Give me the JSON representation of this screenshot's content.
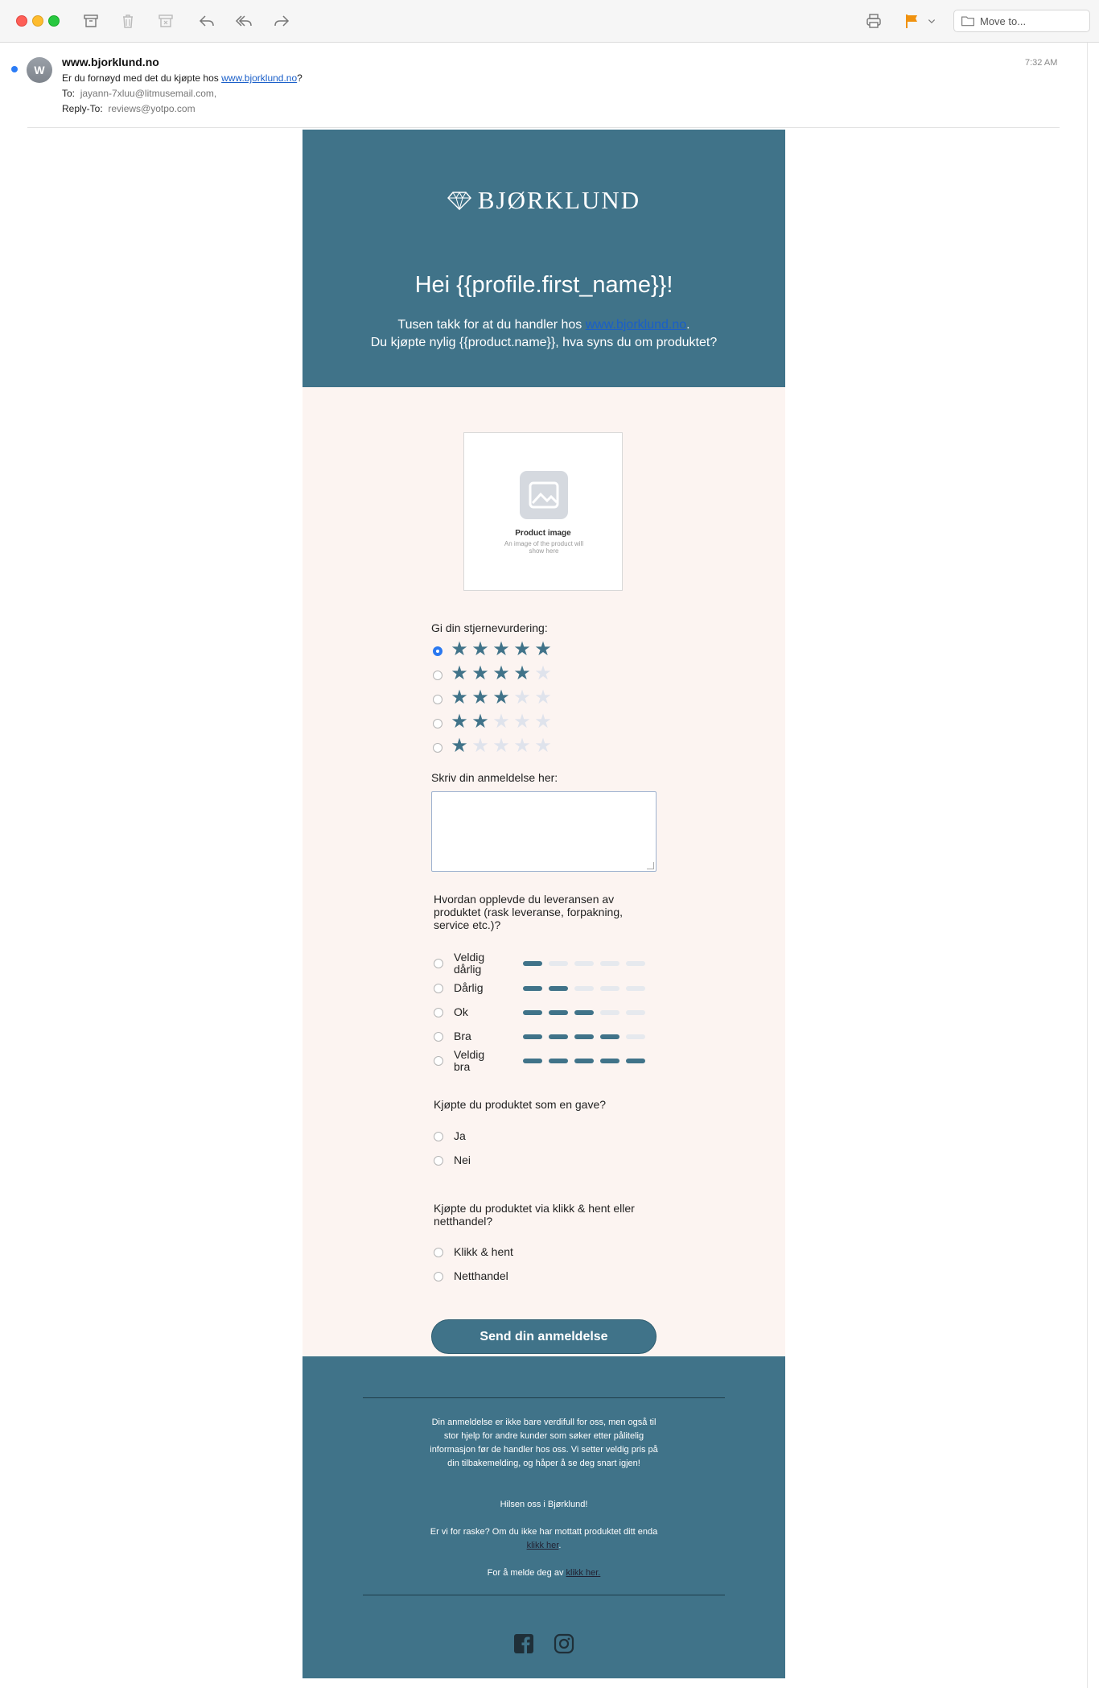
{
  "toolbar": {
    "move_to_placeholder": "Move to..."
  },
  "message": {
    "avatar_initial": "W",
    "sender": "www.bjorklund.no",
    "subject_prefix": "Er du fornøyd med det du kjøpte hos ",
    "subject_link": "www.bjorklund.no",
    "subject_suffix": "?",
    "to_label": "To:",
    "to_value": "jayann-7xluu@litmusemail.com,",
    "reply_to_label": "Reply-To:",
    "reply_to_value": "reviews@yotpo.com",
    "time": "7:32 AM"
  },
  "hero": {
    "logo_text": "BJØRKLUND",
    "greeting": "Hei {{profile.first_name}}!",
    "intro_prefix": "Tusen takk for at du handler hos ",
    "intro_link": "www.bjorklund.no",
    "intro_suffix": ".",
    "intro_line2": "Du kjøpte nylig {{product.name}}, hva syns du om produktet?"
  },
  "product": {
    "title": "Product image",
    "subtitle": "An image of the product will show here"
  },
  "rating": {
    "label": "Gi din stjernevurdering:",
    "selected": 5,
    "options": [
      5,
      4,
      3,
      2,
      1
    ],
    "max": 5
  },
  "review": {
    "label": "Skriv din anmeldelse her:"
  },
  "delivery": {
    "question": "Hvordan opplevde du leveransen av produktet (rask leveranse, forpakning, service etc.)?",
    "options": [
      {
        "label": "Veldig dårlig",
        "level": 1
      },
      {
        "label": "Dårlig",
        "level": 2
      },
      {
        "label": "Ok",
        "level": 3
      },
      {
        "label": "Bra",
        "level": 4
      },
      {
        "label": "Veldig bra",
        "level": 5
      }
    ]
  },
  "gift": {
    "question": "Kjøpte du produktet som en gave?",
    "options": [
      "Ja",
      "Nei"
    ]
  },
  "channel": {
    "question": "Kjøpte du produktet via klikk & hent eller netthandel?",
    "options": [
      "Klikk & hent",
      "Netthandel"
    ]
  },
  "submit_label": "Send din anmeldelse",
  "footer": {
    "paragraph": "Din anmeldelse er ikke bare verdifull for oss, men også til stor hjelp for andre kunder som søker etter pålitelig informasjon før de handler hos oss. Vi setter veldig pris på din tilbakemelding, og håper å se deg snart igjen!",
    "signoff": "Hilsen oss i Bjørklund!",
    "early_prefix": "Er vi for raske? Om du ikke har mottatt produktet ditt enda",
    "early_link": "klikk her",
    "early_suffix": ".",
    "unsub_prefix": "For å melde deg av",
    "unsub_link": "klikk her."
  },
  "colors": {
    "brand": "#407389",
    "body_bg": "#fcf4f1",
    "star_off": "#dfe3ec",
    "link": "#1a5fc9"
  }
}
